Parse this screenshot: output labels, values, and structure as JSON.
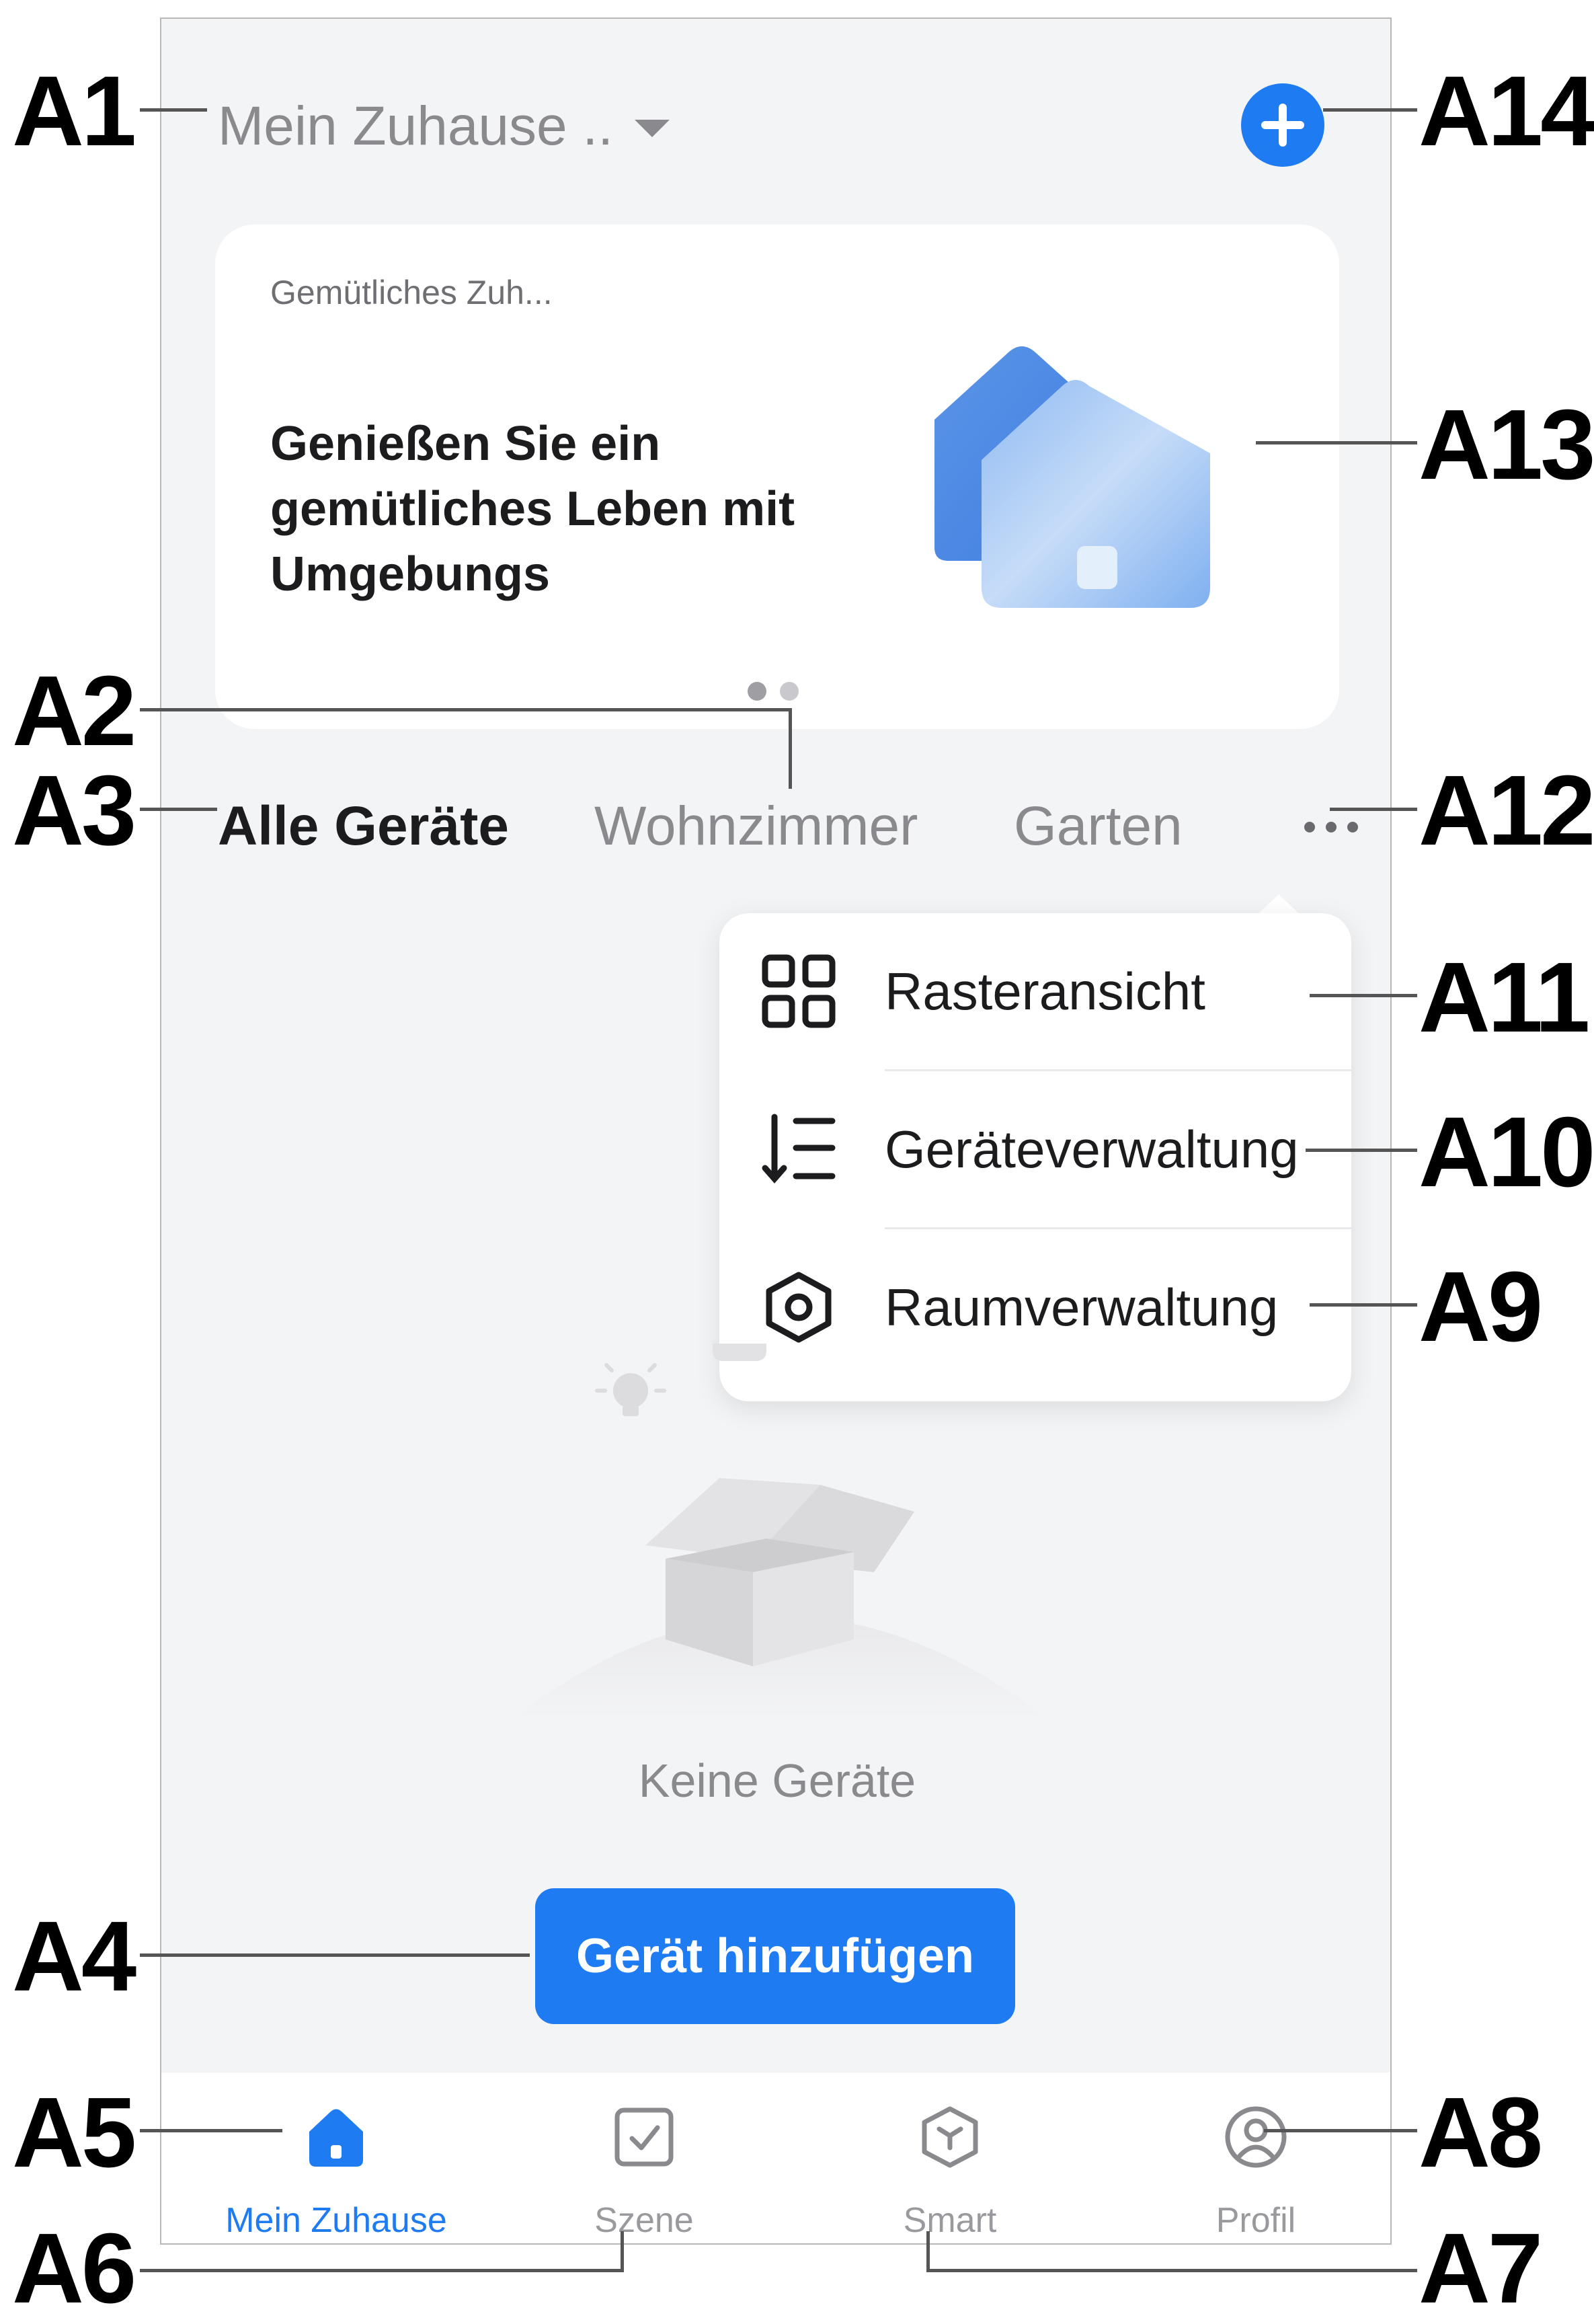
{
  "header": {
    "home_name": "Mein Zuhause ..",
    "add_icon": "plus-circle-icon"
  },
  "banner": {
    "kicker": "Gemütliches Zuh...",
    "headline": "Genießen Sie ein gemütliches Leben mit Umgebungs",
    "illustration": "house-illustration",
    "page_indicator": {
      "pages": 2,
      "active": 1
    }
  },
  "room_tabs": [
    {
      "label": "Alle Geräte",
      "active": true
    },
    {
      "label": "Wohnzimmer",
      "active": false
    },
    {
      "label": "Garten",
      "active": false
    }
  ],
  "more_icon": "more-horizontal-icon",
  "menu": {
    "items": [
      {
        "label": "Rasteransicht",
        "icon": "grid-icon"
      },
      {
        "label": "Geräteverwaltung",
        "icon": "sort-list-icon"
      },
      {
        "label": "Raumverwaltung",
        "icon": "hexagon-settings-icon"
      }
    ]
  },
  "empty_state": {
    "text": "Keine Geräte",
    "illustration": "empty-box-icon"
  },
  "primary_button": {
    "label": "Gerät hinzufügen"
  },
  "bottom_nav": [
    {
      "label": "Mein Zuhause",
      "icon": "home-icon",
      "active": true
    },
    {
      "label": "Szene",
      "icon": "checkbox-icon",
      "active": false
    },
    {
      "label": "Smart",
      "icon": "cube-icon",
      "active": false
    },
    {
      "label": "Profil",
      "icon": "profile-icon",
      "active": false
    }
  ],
  "colors": {
    "accent": "#1e7bf2",
    "background": "#f3f4f6",
    "card": "#ffffff",
    "muted_text": "#8a8a8e"
  },
  "callouts": [
    "A1",
    "A2",
    "A3",
    "A4",
    "A5",
    "A6",
    "A7",
    "A8",
    "A9",
    "A10",
    "A11",
    "A12",
    "A13",
    "A14"
  ]
}
